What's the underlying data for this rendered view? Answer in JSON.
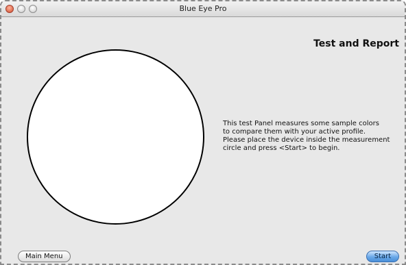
{
  "window": {
    "title": "Blue Eye Pro"
  },
  "panel": {
    "heading": "Test and Report",
    "description": "This test Panel measures some sample colors\nto compare them with your active profile.\nPlease place the device inside the measurement\ncircle and press <Start> to begin."
  },
  "buttons": {
    "main_menu": "Main Menu",
    "start": "Start"
  },
  "colors": {
    "window_bg": "#e8e8e8",
    "start_button": "#6aa8e8",
    "close_button": "#d04a2a"
  }
}
